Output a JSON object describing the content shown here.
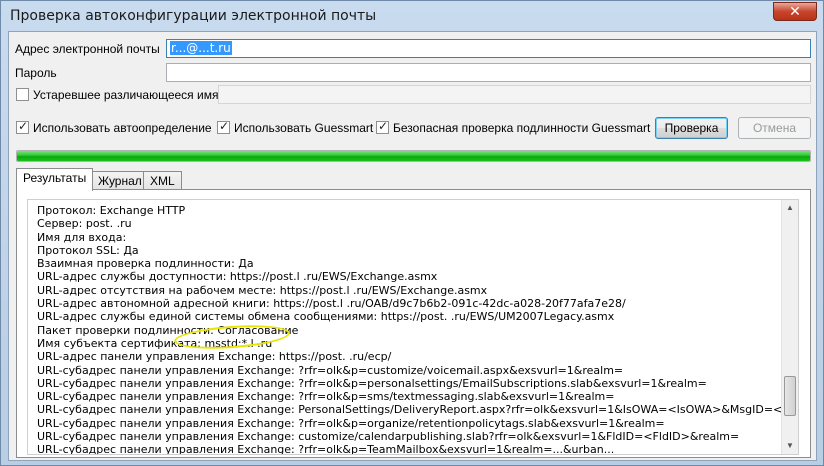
{
  "window": {
    "title": "Проверка автоконфигурации электронной почты",
    "close_glyph": "✕"
  },
  "form": {
    "email_label": "Адрес электронной почты",
    "email_value": "r...@...t.ru",
    "password_label": "Пароль",
    "password_value": "",
    "legacy_label": "Устаревшее различающееся имя",
    "legacy_value": "",
    "legacy_checked": false
  },
  "options": {
    "autodiscover_label": "Использовать автоопределение",
    "autodiscover_checked": true,
    "guessmart_label": "Использовать Guessmart",
    "guessmart_checked": true,
    "secure_guessmart_label": "Безопасная проверка подлинности Guessmart",
    "secure_guessmart_checked": true
  },
  "buttons": {
    "test_label": "Проверка",
    "cancel_label": "Отмена"
  },
  "progress": {
    "value": 1.0,
    "color": "#19b81c"
  },
  "tabs": [
    {
      "label": "Результаты",
      "active": true
    },
    {
      "label": "Журнал",
      "active": false
    },
    {
      "label": "XML",
      "active": false
    }
  ],
  "results": {
    "lines": [
      "Протокол: Exchange HTTP",
      "Сервер: post.        .ru",
      "Имя для входа:",
      "Протокол SSL: Да",
      "Взаимная проверка подлинности: Да",
      "URL-адрес службы доступности: https://post.l           .ru/EWS/Exchange.asmx",
      "URL-адрес отсутствия на рабочем месте: https://post.l           .ru/EWS/Exchange.asmx",
      "URL-адрес автономной адресной книги: https://post.l           .ru/OAB/d9c7b6b2-091c-42dc-a028-20f77afa7e28/",
      "URL-адрес службы единой системы обмена сообщениями: https://post.            .ru/EWS/UM2007Legacy.asmx",
      "Пакет проверки подлинности: Согласование",
      "Имя субъекта сертификата: msstd:*.l          .ru",
      "URL-адрес панели управления Exchange: https://post.         .ru/ecp/",
      "URL-субадрес панели управления Exchange: ?rfr=olk&p=customize/voicemail.aspx&exsvurl=1&realm=",
      "URL-субадрес панели управления Exchange: ?rfr=olk&p=personalsettings/EmailSubscriptions.slab&exsvurl=1&realm=",
      "URL-субадрес панели управления Exchange: ?rfr=olk&p=sms/textmessaging.slab&exsvurl=1&realm=",
      "URL-субадрес панели управления Exchange: PersonalSettings/DeliveryReport.aspx?rfr=olk&exsvurl=1&IsOWA=<IsOWA>&MsgID=<MsgID>&Mb",
      "URL-субадрес панели управления Exchange: ?rfr=olk&p=organize/retentionpolicytags.slab&exsvurl=1&realm=",
      "URL-субадрес панели управления Exchange: customize/calendarpublishing.slab?rfr=olk&exsvurl=1&FldID=<FldID>&realm=",
      "URL-субадрес панели управления Exchange: ?rfr=olk&p=TeamMailbox&exsvurl=1&realm=...&urban..."
    ]
  }
}
